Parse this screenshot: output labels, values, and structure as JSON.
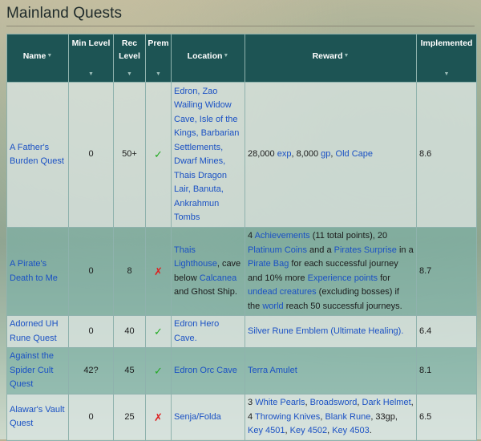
{
  "page": {
    "title": "Mainland Quests"
  },
  "table": {
    "headers": {
      "name": "Name",
      "min_level": "Min Level",
      "rec_level_1": "Rec",
      "rec_level_2": "Level",
      "prem": "Prem",
      "location": "Location",
      "reward": "Reward",
      "implemented": "Implemented"
    },
    "rows": [
      {
        "name": "A Father's Burden Quest",
        "min_level": "0",
        "rec_level": "50+",
        "prem": "✓",
        "location": "Edron, Zao Wailing Widow Cave, Isle of the Kings, Barbarian Settlements, Dwarf Mines, Thais Dragon Lair, Banuta, Ankrahmun Tombs",
        "reward": {
          "t1": "28,000 ",
          "l1": "exp",
          "t2": ", 8,000 ",
          "l2": "gp",
          "t3": ", ",
          "l3": "Old Cape"
        },
        "implemented": "8.6"
      },
      {
        "name": "A Pirate's Death to Me",
        "min_level": "0",
        "rec_level": "8",
        "prem": "✗",
        "location": {
          "l1": "Thais Lighthouse",
          "t1": ", cave below ",
          "l2": "Calcanea",
          "t2": " and Ghost Ship."
        },
        "reward": {
          "t1": "4 ",
          "l1": "Achievements",
          "t2": " (11 total points), 20 ",
          "l2": "Platinum Coins",
          "t3": " and a ",
          "l3": "Pirates Surprise",
          "t4": " in a ",
          "l4": "Pirate Bag",
          "t5": " for each successful journey and 10% more ",
          "l5": "Experience points",
          "t6": " for ",
          "l6": "undead creatures",
          "t7": " (excluding bosses) if the ",
          "l7": "world",
          "t8": " reach 50 successful journeys."
        },
        "implemented": "8.7"
      },
      {
        "name": "Adorned UH Rune Quest",
        "min_level": "0",
        "rec_level": "40",
        "prem": "✓",
        "location": "Edron Hero Cave.",
        "reward": "Silver Rune Emblem (Ultimate Healing).",
        "implemented": "6.4"
      },
      {
        "name": "Against the Spider Cult Quest",
        "min_level": "42?",
        "rec_level": "45",
        "prem": "✓",
        "location": "Edron Orc Cave",
        "reward": "Terra Amulet",
        "implemented": "8.1"
      },
      {
        "name": "Alawar's Vault Quest",
        "min_level": "0",
        "rec_level": "25",
        "prem": "✗",
        "location": "Senja/Folda",
        "reward": {
          "t1": "3 ",
          "l1": "White Pearls",
          "t2": ", ",
          "l2": "Broadsword",
          "t3": ", ",
          "l3": "Dark Helmet",
          "t4": ", 4 ",
          "l4": "Throwing Knives",
          "t5": ", ",
          "l5": "Blank Rune",
          "t6": ", 33gp, ",
          "l6": "Key 4501",
          "t7": ", ",
          "l7": "Key 4502",
          "t8": ", ",
          "l8": "Key 4503",
          "t9": "."
        },
        "implemented": "6.5"
      }
    ]
  },
  "colors": {
    "header_bg": "#1d5454",
    "link": "#1a51c4",
    "check": "#22aa22",
    "cross": "#dd2020"
  }
}
